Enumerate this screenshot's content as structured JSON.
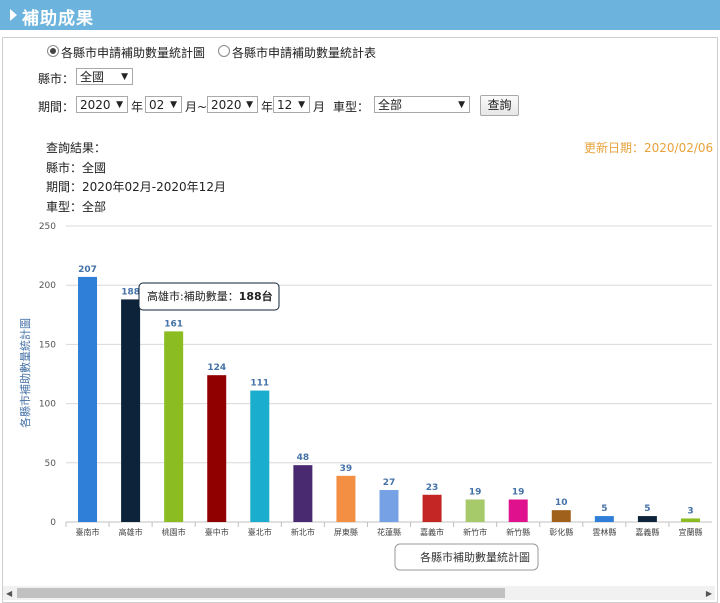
{
  "header": {
    "title": "補助成果"
  },
  "mode": {
    "options": [
      {
        "label": "各縣市申請補助數量統計圖",
        "selected": true
      },
      {
        "label": "各縣市申請補助數量統計表",
        "selected": false
      }
    ]
  },
  "filters": {
    "county_label": "縣市：",
    "county_value": "全國",
    "period_label": "期間：",
    "start_year": "2020",
    "year_unit": "年",
    "start_month": "02",
    "month_unit_tilde": "月~",
    "end_year": "2020",
    "end_month": "12",
    "month_unit": "月",
    "type_label": "車型：",
    "type_value": "全部",
    "query_button": "查詢"
  },
  "result": {
    "heading": "查詢結果：",
    "county_line": "縣市：全國",
    "period_line": "期間：2020年02月-2020年12月",
    "type_line": "車型：全部",
    "update_date": "更新日期：2020/02/06"
  },
  "tooltip": {
    "prefix": "高雄市:補助數量：",
    "value": "188台"
  },
  "chart_data": {
    "type": "bar",
    "ylabel": "各縣市補助數量統計圖",
    "legend": "各縣市補助數量統計圖",
    "ylim": [
      0,
      250
    ],
    "yticks": [
      0,
      50,
      100,
      150,
      200,
      250
    ],
    "grid": true,
    "categories": [
      "臺南市",
      "高雄市",
      "桃園市",
      "臺中市",
      "臺北市",
      "新北市",
      "屏東縣",
      "花蓮縣",
      "嘉義市",
      "新竹市",
      "新竹縣",
      "彰化縣",
      "雲林縣",
      "嘉義縣",
      "宜蘭縣"
    ],
    "values": [
      207,
      188,
      161,
      124,
      111,
      48,
      39,
      27,
      23,
      19,
      19,
      10,
      5,
      5,
      3
    ],
    "colors": [
      "#2f7ed8",
      "#0d233a",
      "#8bbc21",
      "#910000",
      "#1aadce",
      "#492970",
      "#f28f43",
      "#77a1e5",
      "#c42525",
      "#a6c96a",
      "#e0118c",
      "#a0611d",
      "#2f7ed8",
      "#0d233a",
      "#8bbc21"
    ]
  }
}
